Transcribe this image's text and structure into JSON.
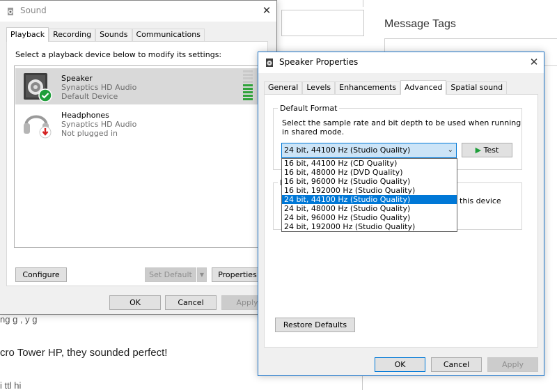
{
  "background": {
    "heading": "Message Tags",
    "text_line_1": "ng g    ,         y                         g",
    "text_line_2": "cro Tower HP, they sounded perfect!",
    "text_line_3": "  i    ttl   hi"
  },
  "sound_window": {
    "title": "Sound",
    "tabs": [
      "Playback",
      "Recording",
      "Sounds",
      "Communications"
    ],
    "instruction": "Select a playback device below to modify its settings:",
    "devices": [
      {
        "name": "Speaker",
        "driver": "Synaptics HD Audio",
        "status": "Default Device"
      },
      {
        "name": "Headphones",
        "driver": "Synaptics HD Audio",
        "status": "Not plugged in"
      }
    ],
    "buttons": {
      "configure": "Configure",
      "set_default": "Set Default",
      "properties": "Properties",
      "ok": "OK",
      "cancel": "Cancel",
      "apply": "Apply"
    }
  },
  "props_window": {
    "title": "Speaker Properties",
    "tabs": [
      "General",
      "Levels",
      "Enhancements",
      "Advanced",
      "Spatial sound"
    ],
    "active_tab": "Advanced",
    "default_format": {
      "label": "Default Format",
      "description_1": "Select the sample rate and bit depth to be used when running",
      "description_2": "in shared mode.",
      "selected": "24 bit, 44100 Hz (Studio Quality)",
      "options": [
        "16 bit, 44100 Hz (CD Quality)",
        "16 bit, 48000 Hz (DVD Quality)",
        "16 bit, 96000 Hz (Studio Quality)",
        "16 bit, 192000 Hz (Studio Quality)",
        "24 bit, 44100 Hz (Studio Quality)",
        "24 bit, 48000 Hz (Studio Quality)",
        "24 bit, 96000 Hz (Studio Quality)",
        "24 bit, 192000 Hz (Studio Quality)"
      ],
      "test_label": "Test"
    },
    "exclusive": {
      "label_fragment": "E",
      "text_fragment": "this device"
    },
    "buttons": {
      "restore": "Restore Defaults",
      "ok": "OK",
      "cancel": "Cancel",
      "apply": "Apply"
    }
  },
  "colors": {
    "accent": "#0078d7",
    "selection_bg": "#cce4f7",
    "check_green": "#1e9e3a",
    "unplug_red": "#d42020",
    "level_green": "#2fa33a"
  }
}
